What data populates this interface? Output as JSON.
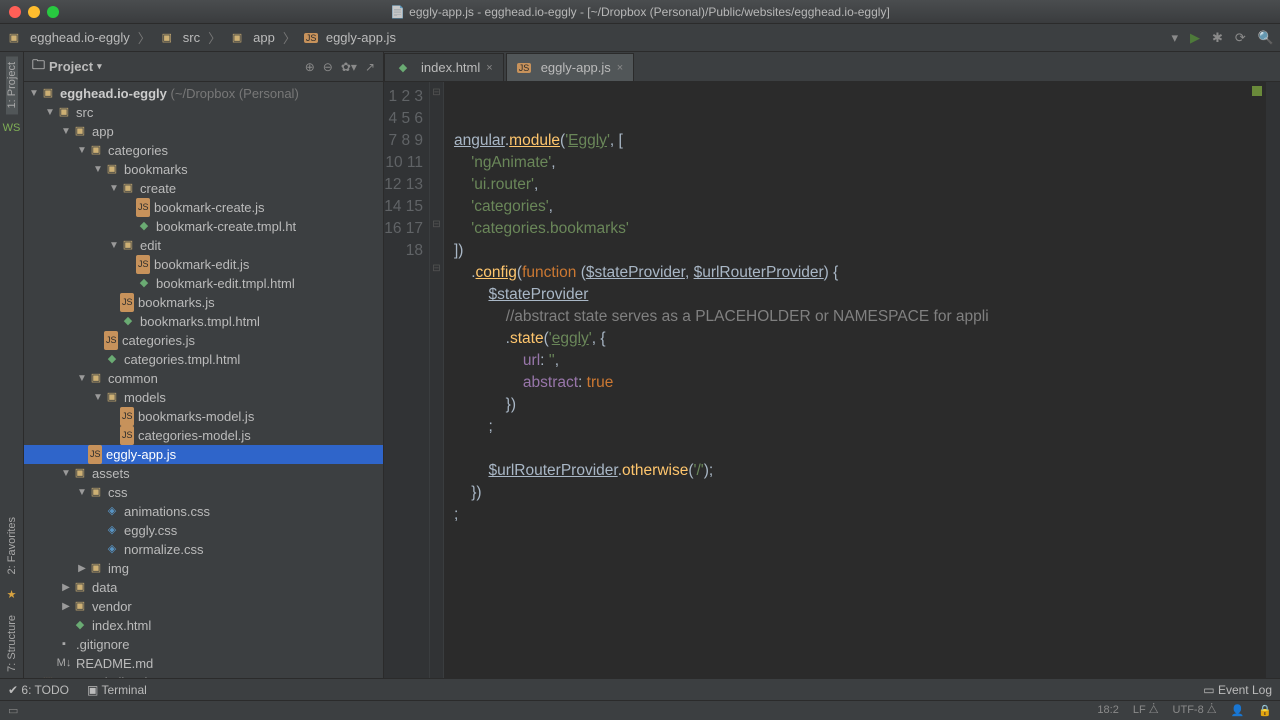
{
  "title": "eggly-app.js - egghead.io-eggly - [~/Dropbox (Personal)/Public/websites/egghead.io-eggly]",
  "breadcrumb": [
    "egghead.io-eggly",
    "src",
    "app",
    "eggly-app.js"
  ],
  "panel_label": "Project",
  "left_rail": {
    "project": "1: Project",
    "favorites": "2: Favorites",
    "structure": "7: Structure"
  },
  "tree": {
    "root": "egghead.io-eggly",
    "root_hint": "(~/Dropbox (Personal)",
    "src": "src",
    "app": "app",
    "categories": "categories",
    "bookmarks": "bookmarks",
    "create": "create",
    "create_js": "bookmark-create.js",
    "create_tmpl": "bookmark-create.tmpl.ht",
    "edit": "edit",
    "edit_js": "bookmark-edit.js",
    "edit_tmpl": "bookmark-edit.tmpl.html",
    "bookmarks_js": "bookmarks.js",
    "bookmarks_tmpl": "bookmarks.tmpl.html",
    "categories_js": "categories.js",
    "categories_tmpl": "categories.tmpl.html",
    "common": "common",
    "models": "models",
    "bm_model": "bookmarks-model.js",
    "cat_model": "categories-model.js",
    "eggly_app": "eggly-app.js",
    "assets": "assets",
    "css": "css",
    "anim": "animations.css",
    "egglycss": "eggly.css",
    "norm": "normalize.css",
    "img": "img",
    "data": "data",
    "vendor": "vendor",
    "indexhtml": "index.html",
    "gitignore": ".gitignore",
    "readme": "README.md",
    "extlib": "External Libraries"
  },
  "tabs": [
    {
      "label": "index.html",
      "icon": "html"
    },
    {
      "label": "eggly-app.js",
      "icon": "js"
    }
  ],
  "code_lines": 18,
  "bottombar": {
    "todo": "6: TODO",
    "terminal": "Terminal",
    "eventlog": "Event Log"
  },
  "status": {
    "pos": "18:2",
    "lf": "LF",
    "enc": "UTF-8",
    "insp": "⎋"
  },
  "chart_data": null
}
